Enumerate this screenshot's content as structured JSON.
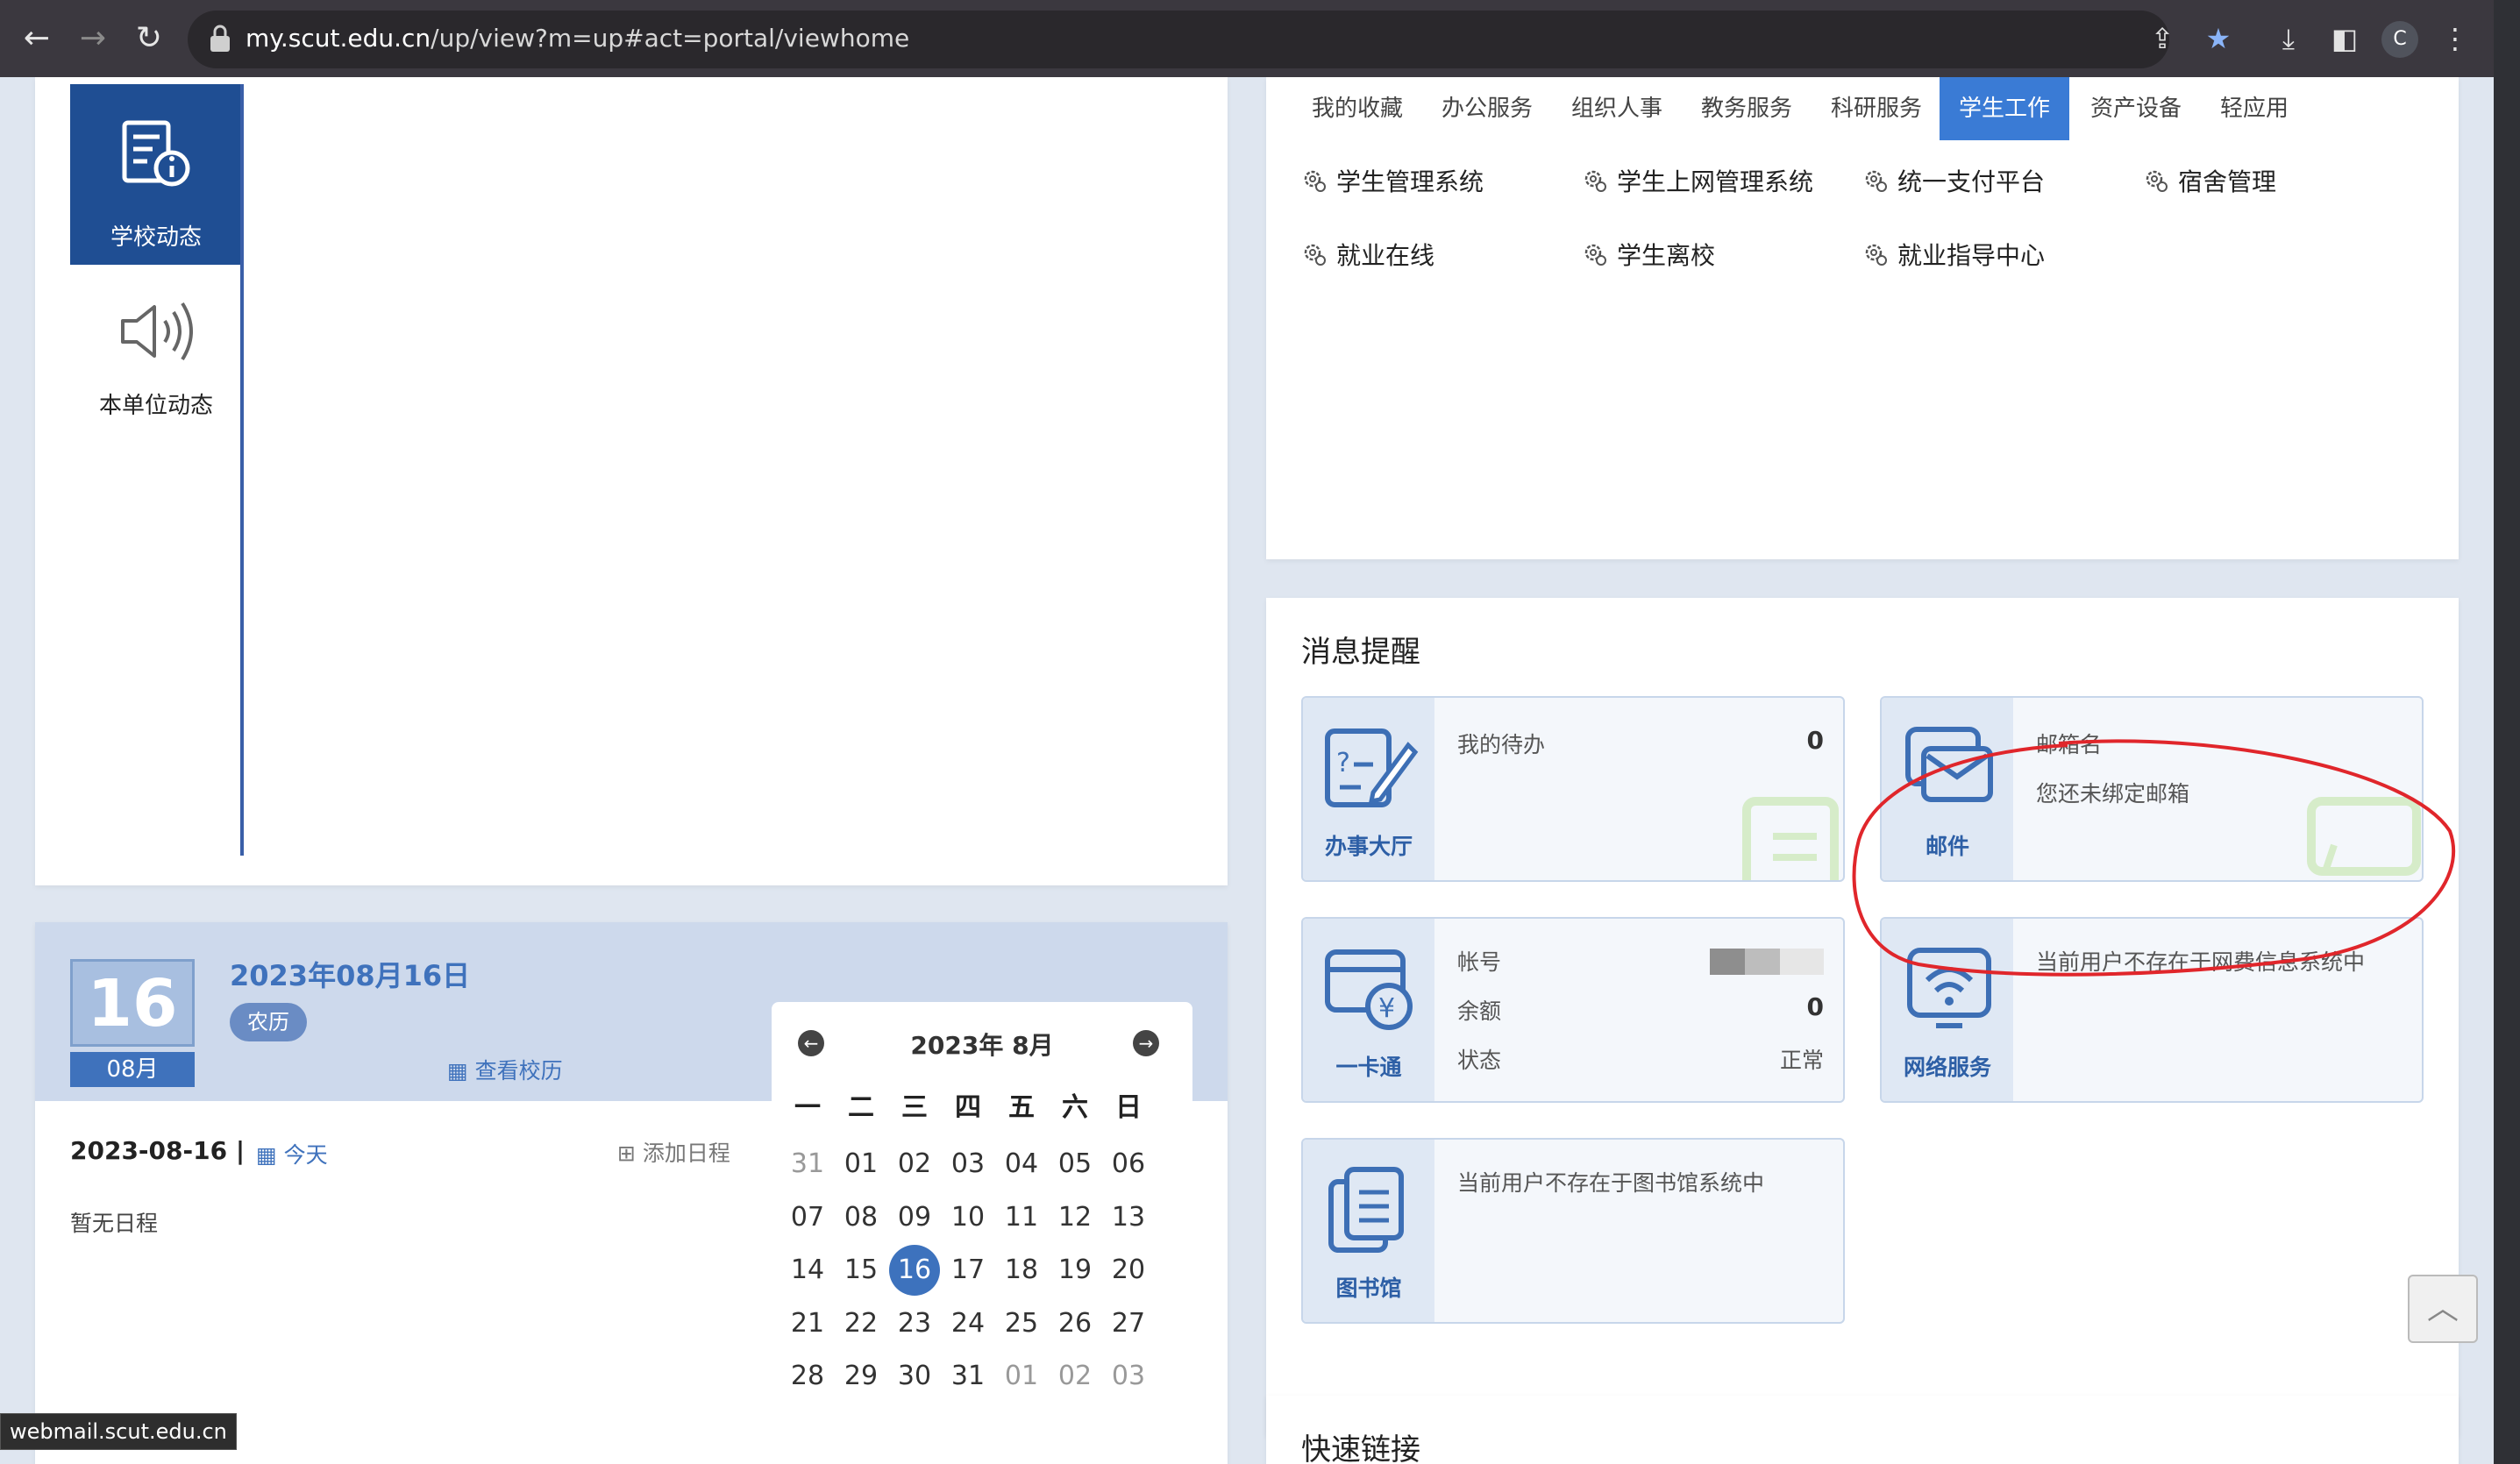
{
  "browser": {
    "url_host": "my.scut.edu.cn",
    "url_path": "/up/view?m=up#act=portal/viewhome",
    "avatar_letter": "C"
  },
  "news_sidebar": {
    "tabs": [
      {
        "label": "学校动态",
        "active": true
      },
      {
        "label": "本单位动态",
        "active": false
      }
    ]
  },
  "apps": {
    "tabs": [
      "我的收藏",
      "办公服务",
      "组织人事",
      "教务服务",
      "科研服务",
      "学生工作",
      "资产设备",
      "轻应用"
    ],
    "active_tab": "学生工作",
    "items": [
      "学生管理系统",
      "学生上网管理系统",
      "统一支付平台",
      "宿舍管理",
      "就业在线",
      "学生离校",
      "就业指导中心"
    ]
  },
  "reminders": {
    "title": "消息提醒",
    "todo": {
      "side_label": "办事大厅",
      "label": "我的待办",
      "value": "0"
    },
    "mail": {
      "side_label": "邮件",
      "label": "邮箱名",
      "status": "您还未绑定邮箱"
    },
    "card": {
      "side_label": "一卡通",
      "account_label": "帐号",
      "balance_label": "余额",
      "balance_value": "0",
      "state_label": "状态",
      "state_value": "正常"
    },
    "network": {
      "side_label": "网络服务",
      "message": "当前用户不存在于网费信息系统中"
    },
    "library": {
      "side_label": "图书馆",
      "message": "当前用户不存在于图书馆系统中"
    }
  },
  "quick_links": {
    "title": "快速链接"
  },
  "schedule": {
    "day": "16",
    "month": "08月",
    "full_date": "2023年08月16日",
    "lunar_label": "农历",
    "view_calendar_label": "查看校历",
    "date_line": "2023-08-16",
    "today_label": "今天",
    "add_label": "添加日程",
    "empty_text": "暂无日程"
  },
  "calendar": {
    "title": "2023年 8月",
    "weekdays": [
      "一",
      "二",
      "三",
      "四",
      "五",
      "六",
      "日"
    ],
    "weeks": [
      [
        "31",
        "01",
        "02",
        "03",
        "04",
        "05",
        "06"
      ],
      [
        "07",
        "08",
        "09",
        "10",
        "11",
        "12",
        "13"
      ],
      [
        "14",
        "15",
        "16",
        "17",
        "18",
        "19",
        "20"
      ],
      [
        "21",
        "22",
        "23",
        "24",
        "25",
        "26",
        "27"
      ],
      [
        "28",
        "29",
        "30",
        "31",
        "01",
        "02",
        "03"
      ]
    ],
    "today": "16"
  },
  "status_bar": {
    "text": "webmail.scut.edu.cn"
  },
  "colors": {
    "brand": "#1f4e93",
    "accent": "#3a7bd5",
    "annotation": "#e0262b"
  }
}
